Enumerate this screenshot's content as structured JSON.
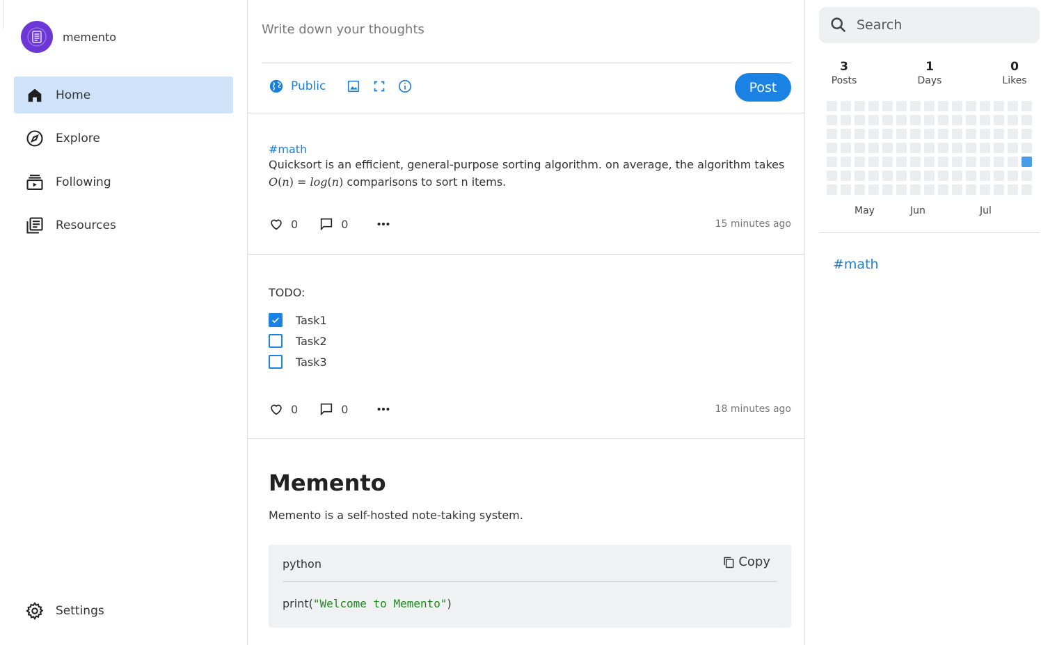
{
  "app": {
    "name": "memento"
  },
  "sidebar": {
    "items": [
      {
        "label": "Home",
        "icon": "home-icon",
        "active": true
      },
      {
        "label": "Explore",
        "icon": "compass-icon",
        "active": false
      },
      {
        "label": "Following",
        "icon": "subscriptions-icon",
        "active": false
      },
      {
        "label": "Resources",
        "icon": "library-icon",
        "active": false
      }
    ],
    "settings": {
      "label": "Settings",
      "icon": "gear-icon"
    }
  },
  "composer": {
    "placeholder": "Write down your thoughts",
    "visibility": "Public",
    "tools": [
      "globe-icon",
      "image-icon",
      "fullscreen-icon",
      "info-icon"
    ],
    "post_label": "Post"
  },
  "posts": [
    {
      "tag": "#math",
      "text": "Quicksort is an efficient, general-purpose sorting algorithm. on average, the algorithm takes",
      "formula": {
        "lhs": "O",
        "lhs_arg": "n",
        "eq": "=",
        "rhs": "log",
        "rhs_arg": "n"
      },
      "text_after": " comparisons to sort n items.",
      "likes": "0",
      "comments": "0",
      "time": "15 minutes ago"
    },
    {
      "title": "TODO:",
      "tasks": [
        {
          "label": "Task1",
          "checked": true
        },
        {
          "label": "Task2",
          "checked": false
        },
        {
          "label": "Task3",
          "checked": false
        }
      ],
      "likes": "0",
      "comments": "0",
      "time": "18 minutes ago"
    },
    {
      "heading": "Memento",
      "text": "Memento is a self-hosted note-taking system.",
      "code": {
        "language": "python",
        "copy_label": "Copy",
        "fn": "print(",
        "string": "\"Welcome to Memento\"",
        "close": ")"
      }
    }
  ],
  "search": {
    "placeholder": "Search"
  },
  "stats": [
    {
      "value": "3",
      "label": "Posts"
    },
    {
      "value": "1",
      "label": "Days"
    },
    {
      "value": "0",
      "label": "Likes"
    }
  ],
  "heatmap": {
    "weeks": 15,
    "days": 7,
    "active_cells": [
      {
        "week": 14,
        "day": 4,
        "level": 1
      }
    ],
    "months": [
      "May",
      "Jun",
      "Jul"
    ],
    "colors": {
      "empty": "#ebedf0",
      "level1": "#4a9ee8"
    }
  },
  "tags": [
    "#math"
  ],
  "colors": {
    "accent": "#1a82e2",
    "active_nav": "#cfe3fa",
    "avatar": "#6d37d6"
  }
}
